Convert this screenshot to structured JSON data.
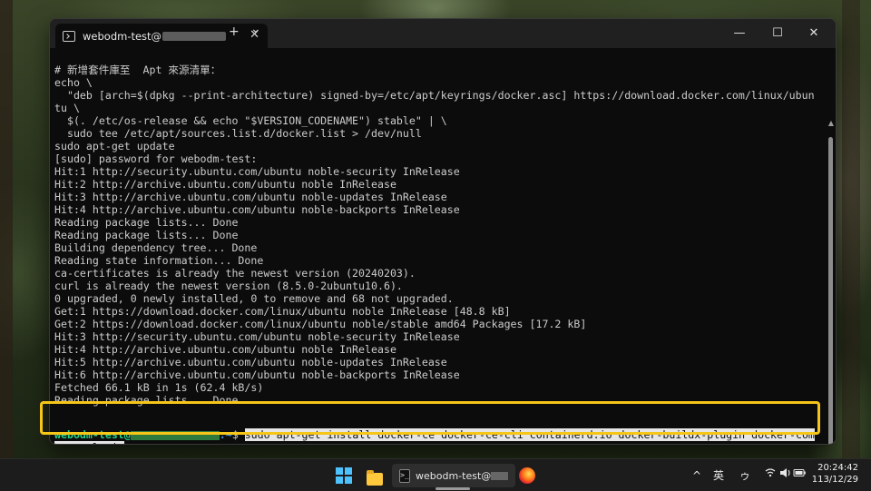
{
  "window": {
    "tab_title": "webodm-test@",
    "tab_close": "✕",
    "new_tab": "+",
    "dropdown": "⌄",
    "minimize": "—",
    "maximize": "☐",
    "close": "✕"
  },
  "terminal": {
    "lines": [
      "# 新增套件庫至  Apt 來源清單：",
      "echo \\",
      "  \"deb [arch=$(dpkg --print-architecture) signed-by=/etc/apt/keyrings/docker.asc] https://download.docker.com/linux/ubun",
      "tu \\",
      "  $(. /etc/os-release && echo \"$VERSION_CODENAME\") stable\" | \\",
      "  sudo tee /etc/apt/sources.list.d/docker.list > /dev/null",
      "sudo apt-get update",
      "[sudo] password for webodm-test:",
      "Hit:1 http://security.ubuntu.com/ubuntu noble-security InRelease",
      "Hit:2 http://archive.ubuntu.com/ubuntu noble InRelease",
      "Hit:3 http://archive.ubuntu.com/ubuntu noble-updates InRelease",
      "Hit:4 http://archive.ubuntu.com/ubuntu noble-backports InRelease",
      "Reading package lists... Done",
      "Reading package lists... Done",
      "Building dependency tree... Done",
      "Reading state information... Done",
      "ca-certificates is already the newest version (20240203).",
      "curl is already the newest version (8.5.0-2ubuntu10.6).",
      "0 upgraded, 0 newly installed, 0 to remove and 68 not upgraded.",
      "Get:1 https://download.docker.com/linux/ubuntu noble InRelease [48.8 kB]",
      "Get:2 https://download.docker.com/linux/ubuntu noble/stable amd64 Packages [17.2 kB]",
      "Hit:3 http://security.ubuntu.com/ubuntu noble-security InRelease",
      "Hit:4 http://archive.ubuntu.com/ubuntu noble InRelease",
      "Hit:5 http://archive.ubuntu.com/ubuntu noble-updates InRelease",
      "Hit:6 http://archive.ubuntu.com/ubuntu noble-backports InRelease",
      "Fetched 66.1 kB in 1s (62.4 kB/s)",
      "Reading package lists... Done"
    ],
    "prompt_user": "webodm-test@",
    "prompt_path": ":~",
    "prompt_symbol": "$",
    "command_line1": "sudo apt-get install docker-ce docker-ce-cli containerd.io docker-buildx-plugin docker-com",
    "command_line2": "pose-plugin"
  },
  "taskbar": {
    "terminal_label": "webodm-test@",
    "tray_chevron": "^",
    "ime_label": "英",
    "ime_mode": "ゥ",
    "clock_time": "20:24:42",
    "clock_date": "113/12/29"
  },
  "colors": {
    "prompt_user": "#23d18b",
    "highlight_border": "#f5c518",
    "terminal_bg": "#0c0c0c"
  },
  "icons": [
    "terminal-icon",
    "windows-start-icon",
    "file-explorer-icon",
    "firefox-icon",
    "wifi-icon",
    "volume-icon",
    "battery-icon"
  ]
}
